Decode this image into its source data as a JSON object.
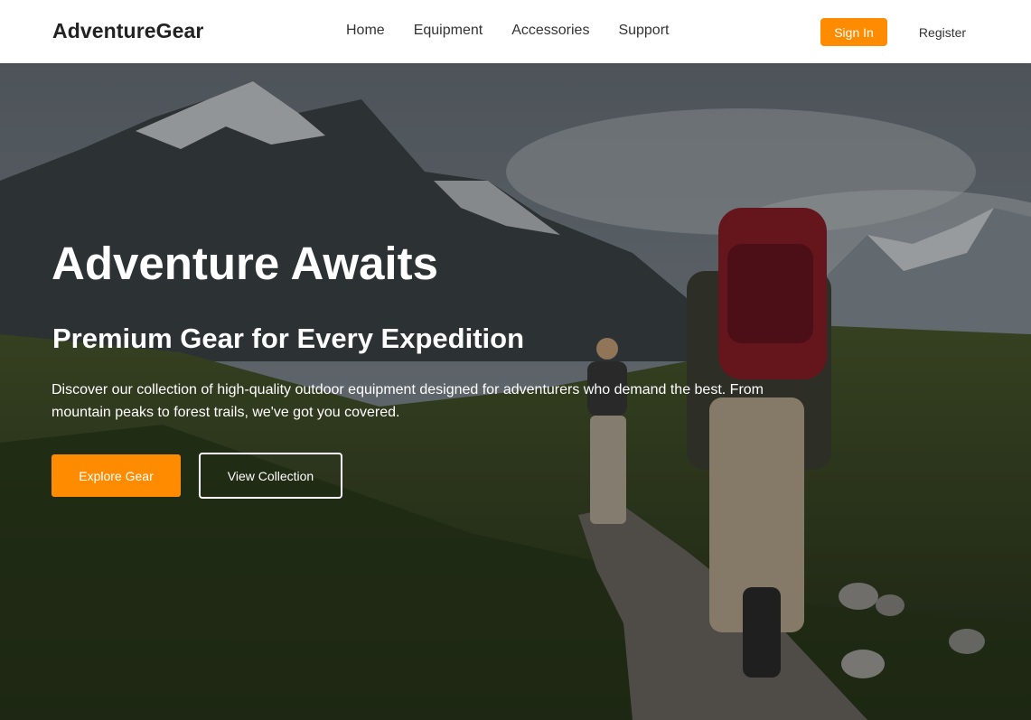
{
  "header": {
    "brand": "AdventureGear",
    "nav": [
      {
        "label": "Home"
      },
      {
        "label": "Equipment"
      },
      {
        "label": "Accessories"
      },
      {
        "label": "Support"
      }
    ],
    "sign_in_label": "Sign In",
    "register_label": "Register"
  },
  "hero": {
    "title": "Adventure Awaits",
    "subtitle": "Premium Gear for Every Expedition",
    "description": "Discover our collection of high-quality outdoor equipment designed for adventurers who demand the best. From mountain peaks to forest trails, we've got you covered.",
    "primary_button_label": "Explore Gear",
    "secondary_button_label": "View Collection"
  },
  "colors": {
    "accent": "#ff8c00",
    "header_bg": "#ffffff",
    "hero_text": "#ffffff"
  }
}
